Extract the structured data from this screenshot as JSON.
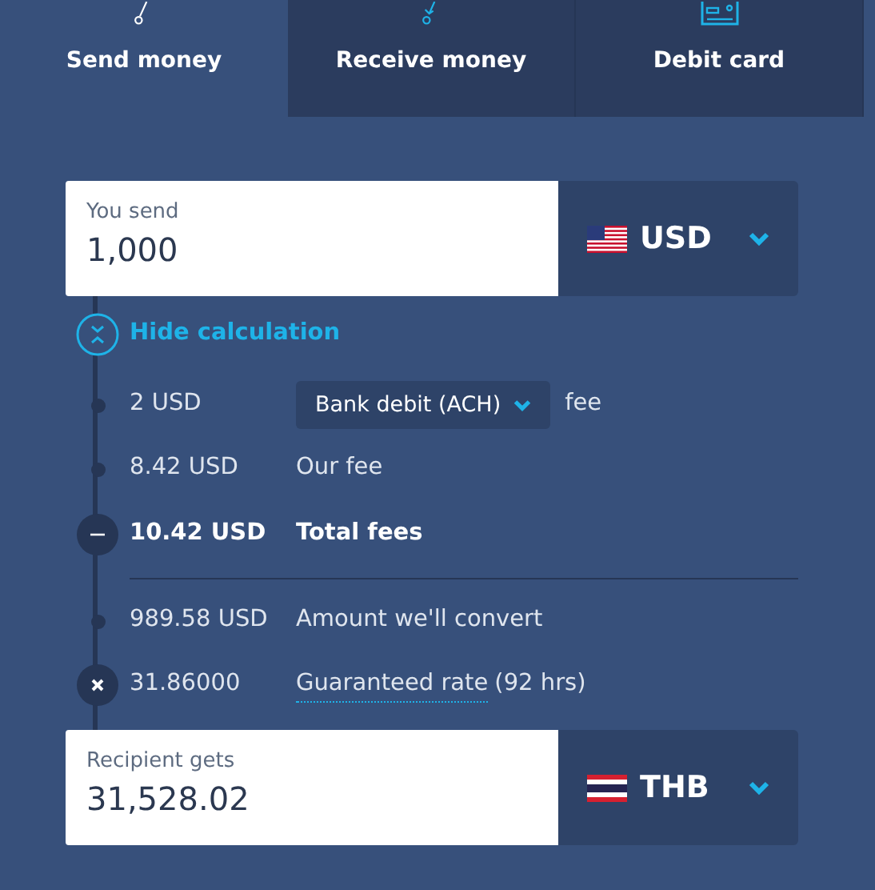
{
  "tabs": [
    {
      "label": "Send money",
      "selected": true
    },
    {
      "label": "Receive money",
      "selected": false
    },
    {
      "label": "Debit card",
      "selected": false
    }
  ],
  "send": {
    "label": "You send",
    "value": "1,000",
    "currency": "USD"
  },
  "toggle": {
    "label": "Hide calculation"
  },
  "breakdown": [
    {
      "kind": "method",
      "amount": "2 USD",
      "method": "Bank debit (ACH)",
      "suffix": "fee"
    },
    {
      "kind": "plain",
      "amount": "8.42 USD",
      "label": "Our fee"
    },
    {
      "kind": "total",
      "amount": "10.42 USD",
      "label": "Total fees"
    },
    {
      "kind": "plain",
      "amount": "989.58 USD",
      "label": "Amount we'll convert"
    },
    {
      "kind": "rate",
      "amount": "31.86000",
      "link": "Guaranteed rate",
      "label": "(92 hrs)"
    }
  ],
  "receive": {
    "label": "Recipient gets",
    "value": "31,528.02",
    "currency": "THB"
  }
}
